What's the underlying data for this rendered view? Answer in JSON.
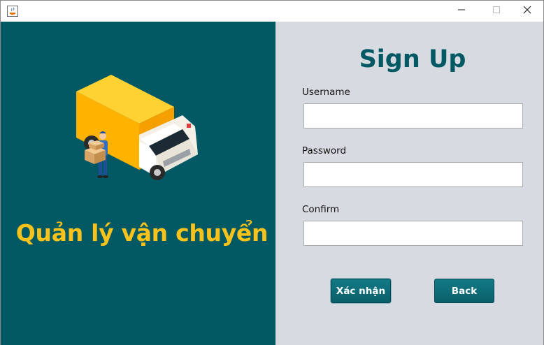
{
  "window": {
    "title": "",
    "controls": [
      "minimize-icon",
      "maximize-icon",
      "close-icon"
    ]
  },
  "left_panel": {
    "illustration": "delivery-truck-icon",
    "brand_title": "Quản lý vận chuyển"
  },
  "form": {
    "title": "Sign Up",
    "username_label": "Username",
    "username_value": "",
    "password_label": "Password",
    "password_value": "",
    "confirm_label": "Confirm",
    "confirm_value": "",
    "confirm_button": "Xác nhận",
    "back_button": "Back"
  },
  "colors": {
    "left_panel_bg": "#025964",
    "right_panel_bg": "#d7dbe1",
    "brand_title": "#f7c21b",
    "form_title": "#025964",
    "button": "#0e6e79"
  }
}
